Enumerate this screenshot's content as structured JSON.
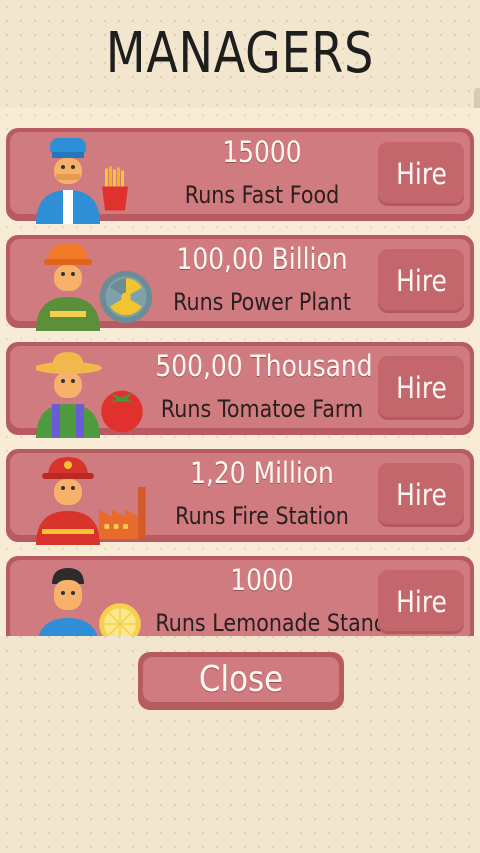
{
  "screen_title": "MANAGERS",
  "managers": [
    {
      "value": "15000",
      "label": "Runs Fast Food",
      "hire": "Hire",
      "avatar_icon": "chef-icon",
      "business_icon": "fries-icon"
    },
    {
      "value": "100,00 Billion",
      "label": "Runs Power Plant",
      "hire": "Hire",
      "avatar_icon": "engineer-icon",
      "business_icon": "radiation-icon"
    },
    {
      "value": "500,00 Thousand",
      "label": "Runs Tomatoe Farm",
      "hire": "Hire",
      "avatar_icon": "farmer-icon",
      "business_icon": "tomato-icon"
    },
    {
      "value": "1,20 Million",
      "label": "Runs Fire Station",
      "hire": "Hire",
      "avatar_icon": "firefighter-icon",
      "business_icon": "factory-icon"
    },
    {
      "value": "1000",
      "label": "Runs Lemonade Stand",
      "hire": "Hire",
      "avatar_icon": "person-icon",
      "business_icon": "lemon-icon"
    }
  ],
  "close_label": "Close",
  "colors": {
    "card": "#cf7b7f",
    "card_border": "#b85a62",
    "background": "#f3e6cf"
  }
}
